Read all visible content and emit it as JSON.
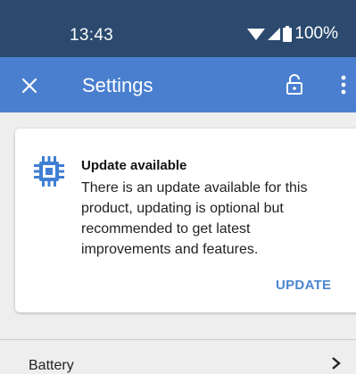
{
  "status_bar": {
    "time": "13:43",
    "battery_text": "100%",
    "icons": [
      "wifi-icon",
      "signal-icon",
      "battery-icon"
    ]
  },
  "app_bar": {
    "title": "Settings",
    "icons": [
      "close-icon",
      "lock-open-icon",
      "more-vert-icon"
    ],
    "color": "#4a7fcf"
  },
  "update_card": {
    "icon": "chip-icon",
    "title": "Update available",
    "body": "There is an update available for this product, updating is optional but recommended to get latest improvements and features.",
    "action_label": "UPDATE",
    "accent": "#4a86cf"
  },
  "list": {
    "items": [
      {
        "label": "Battery",
        "icon": "chevron-right-icon"
      }
    ]
  }
}
